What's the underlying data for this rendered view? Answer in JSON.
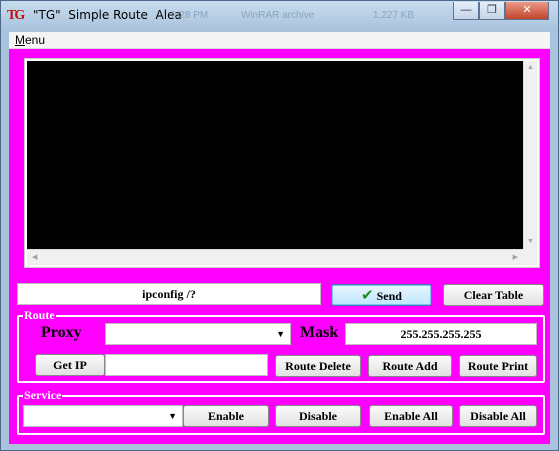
{
  "window": {
    "title": "\"TG\"  Simple Route  Alea",
    "ghost_texts": [
      "2:28 PM",
      "WinRAR archive",
      "1,227 KB"
    ],
    "minimize_glyph": "—",
    "maximize_glyph": "❐",
    "close_glyph": "✕",
    "app_icon": "TG"
  },
  "menu": {
    "items": [
      {
        "first": "M",
        "rest": "enu"
      }
    ]
  },
  "console": {
    "content": "",
    "scroll_up": "▲",
    "scroll_down": "▼",
    "scroll_left": "◀",
    "scroll_right": "▶"
  },
  "command": {
    "value": "ipconfig /?"
  },
  "buttons": {
    "send": "Send",
    "send_icon": "✔",
    "clear_table": "Clear Table",
    "get_ip": "Get IP",
    "route_delete": "Route Delete",
    "route_add": "Route Add",
    "route_print": "Route Print",
    "enable": "Enable",
    "disable": "Disable",
    "enable_all": "Enable All",
    "disable_all": "Disable All"
  },
  "route": {
    "group_title": "Route",
    "proxy_label": "Proxy",
    "proxy_value": "",
    "mask_label": "Mask",
    "mask_value": "255.255.255.255",
    "ip_value": ""
  },
  "service": {
    "group_title": "Service",
    "selected": ""
  },
  "colors": {
    "client_bg": "#ff00ff",
    "console_bg": "#000000",
    "group_text": "#ffffff"
  }
}
